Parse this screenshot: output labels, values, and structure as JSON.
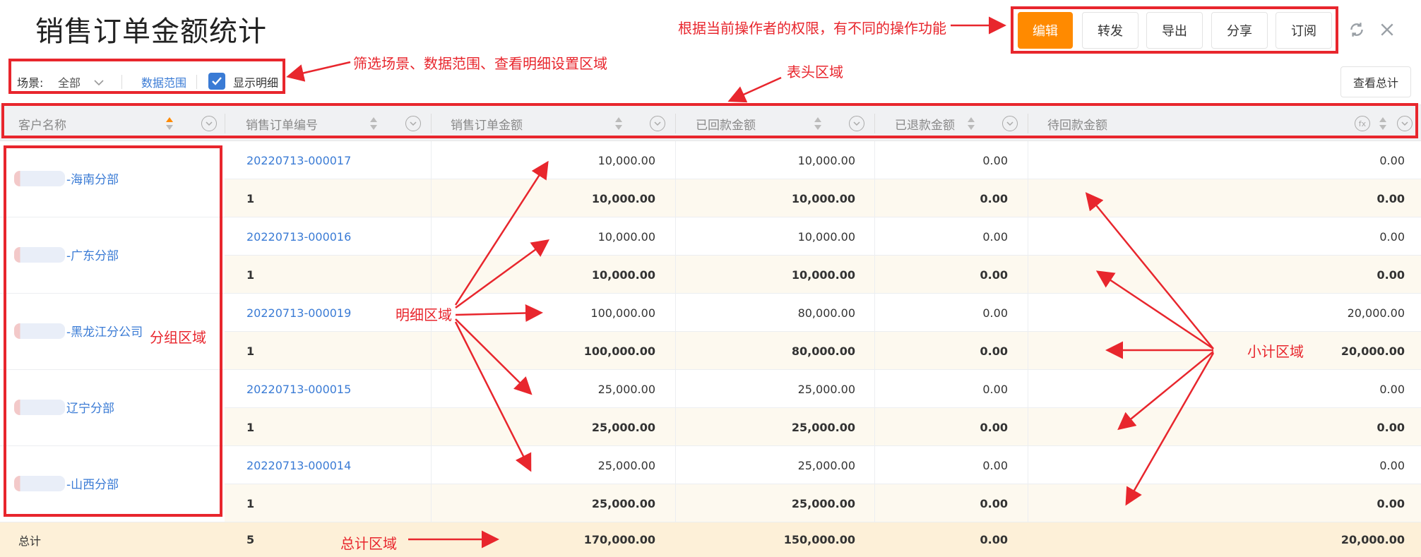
{
  "header": {
    "title": "销售订单金额统计",
    "actions": [
      "编辑",
      "转发",
      "导出",
      "分享",
      "订阅"
    ]
  },
  "filter": {
    "scene_label": "场景:",
    "scene_value": "全部",
    "data_range": "数据范围",
    "show_detail": "显示明细",
    "view_total": "查看总计"
  },
  "table": {
    "columns": [
      "客户名称",
      "销售订单编号",
      "销售订单金额",
      "已回款金额",
      "已退款金额",
      "待回款金额"
    ],
    "groups": [
      {
        "customer": "-海南分部",
        "order": "20220713-000017",
        "amount": "10,000.00",
        "received": "10,000.00",
        "refunded": "0.00",
        "pending": "0.00",
        "sub_count": "1",
        "sub_amount": "10,000.00",
        "sub_received": "10,000.00",
        "sub_refunded": "0.00",
        "sub_pending": "0.00"
      },
      {
        "customer": "-广东分部",
        "order": "20220713-000016",
        "amount": "10,000.00",
        "received": "10,000.00",
        "refunded": "0.00",
        "pending": "0.00",
        "sub_count": "1",
        "sub_amount": "10,000.00",
        "sub_received": "10,000.00",
        "sub_refunded": "0.00",
        "sub_pending": "0.00"
      },
      {
        "customer": "-黑龙江分公司",
        "order": "20220713-000019",
        "amount": "100,000.00",
        "received": "80,000.00",
        "refunded": "0.00",
        "pending": "20,000.00",
        "sub_count": "1",
        "sub_amount": "100,000.00",
        "sub_received": "80,000.00",
        "sub_refunded": "0.00",
        "sub_pending": "20,000.00"
      },
      {
        "customer": "辽宁分部",
        "order": "20220713-000015",
        "amount": "25,000.00",
        "received": "25,000.00",
        "refunded": "0.00",
        "pending": "0.00",
        "sub_count": "1",
        "sub_amount": "25,000.00",
        "sub_received": "25,000.00",
        "sub_refunded": "0.00",
        "sub_pending": "0.00"
      },
      {
        "customer": "-山西分部",
        "order": "20220713-000014",
        "amount": "25,000.00",
        "received": "25,000.00",
        "refunded": "0.00",
        "pending": "0.00",
        "sub_count": "1",
        "sub_amount": "25,000.00",
        "sub_received": "25,000.00",
        "sub_refunded": "0.00",
        "sub_pending": "0.00"
      }
    ],
    "total": {
      "label": "总计",
      "count": "5",
      "amount": "170,000.00",
      "received": "150,000.00",
      "refunded": "0.00",
      "pending": "20,000.00"
    }
  },
  "annotations": {
    "actions_note": "根据当前操作者的权限，有不同的操作功能",
    "filter_note": "筛选场景、数据范围、查看明细设置区域",
    "header_note": "表头区域",
    "group_note": "分组区域",
    "detail_note": "明细区域",
    "subtotal_note": "小计区域",
    "total_note": "总计区域"
  },
  "colors": {
    "accent": "#ff8a00",
    "link": "#3a7bd5",
    "annotation": "#e8262d"
  }
}
